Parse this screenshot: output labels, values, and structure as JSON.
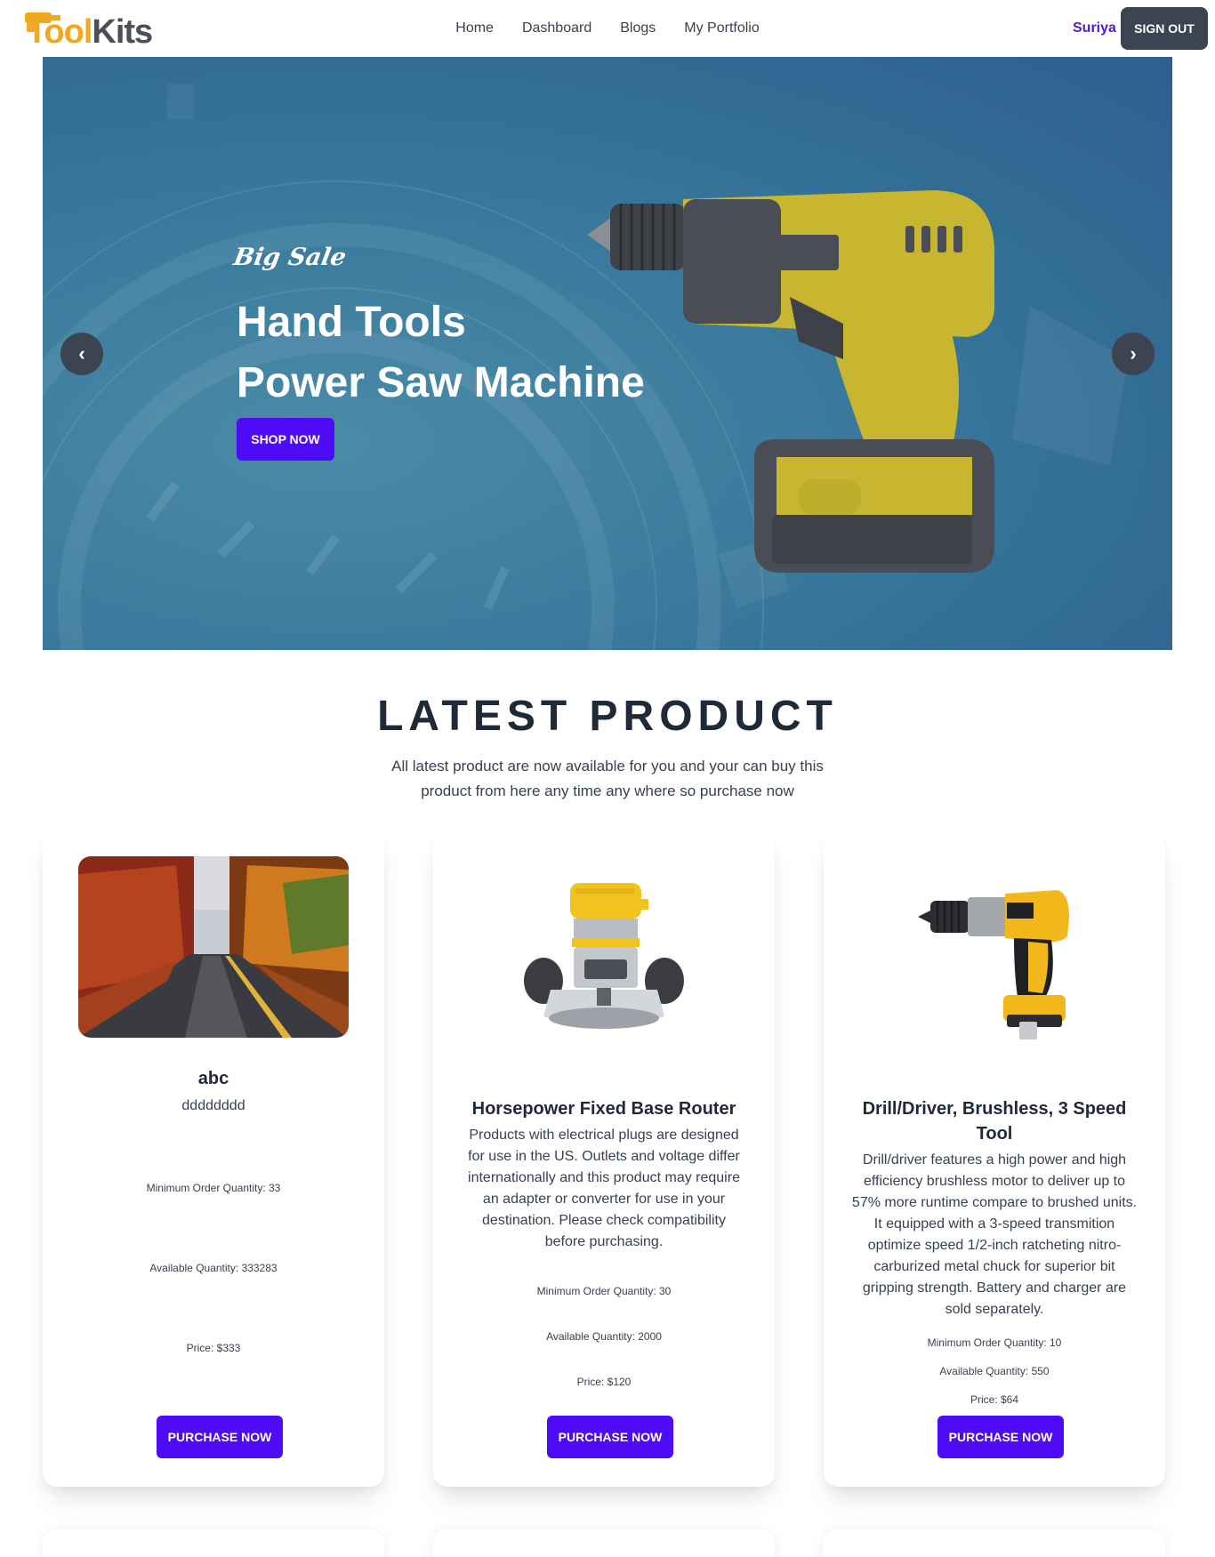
{
  "navbar": {
    "logo": {
      "part1": "Tool",
      "part2": "Kits"
    },
    "links": [
      "Home",
      "Dashboard",
      "Blogs",
      "My Portfolio"
    ],
    "user_name": "Suriya",
    "signout_label": "SIGN OUT"
  },
  "hero": {
    "tag": "Big Sale",
    "title_line1": "Hand Tools",
    "title_line2": "Power Saw Machine",
    "button_label": "SHOP NOW",
    "prev_label": "‹",
    "next_label": "›"
  },
  "section": {
    "title": "LATEST PRODUCT",
    "description": "All latest product are now available for you and your can buy this product from here any time any where so purchase now"
  },
  "products": [
    {
      "name": "abc",
      "description": "dddddddd",
      "min_order": "Minimum Order Quantity: 33",
      "available": "Available Quantity: 333283",
      "price": "Price: $333",
      "button_label": "PURCHASE NOW"
    },
    {
      "name": "Horsepower Fixed Base Router",
      "description": "Products with electrical plugs are designed for use in the US. Outlets and voltage differ internationally and this product may require an adapter or converter for use in your destination. Please check compatibility before purchasing.",
      "min_order": "Minimum Order Quantity: 30",
      "available": "Available Quantity: 2000",
      "price": "Price: $120",
      "button_label": "PURCHASE NOW"
    },
    {
      "name": "Drill/Driver, Brushless, 3 Speed Tool",
      "description": "Drill/driver features a high power and high efficiency brushless motor to deliver up to 57% more runtime compare to brushed units. It equipped with a 3-speed transmition optimize speed 1/2-inch ratcheting nitro-carburized metal chuck for superior bit gripping strength. Battery and charger are sold separately.",
      "min_order": "Minimum Order Quantity: 10",
      "available": "Available Quantity: 550",
      "price": "Price: $64",
      "button_label": "PURCHASE NOW"
    }
  ],
  "colors": {
    "primary": "#4f0bf5",
    "neutral": "#3d4451",
    "logo_orange": "#f0a81e",
    "logo_gray": "#4b4f58",
    "user_name": "#4f1bd1"
  },
  "icons": [
    "drill-logo-icon",
    "chevron-left-icon",
    "chevron-right-icon"
  ]
}
